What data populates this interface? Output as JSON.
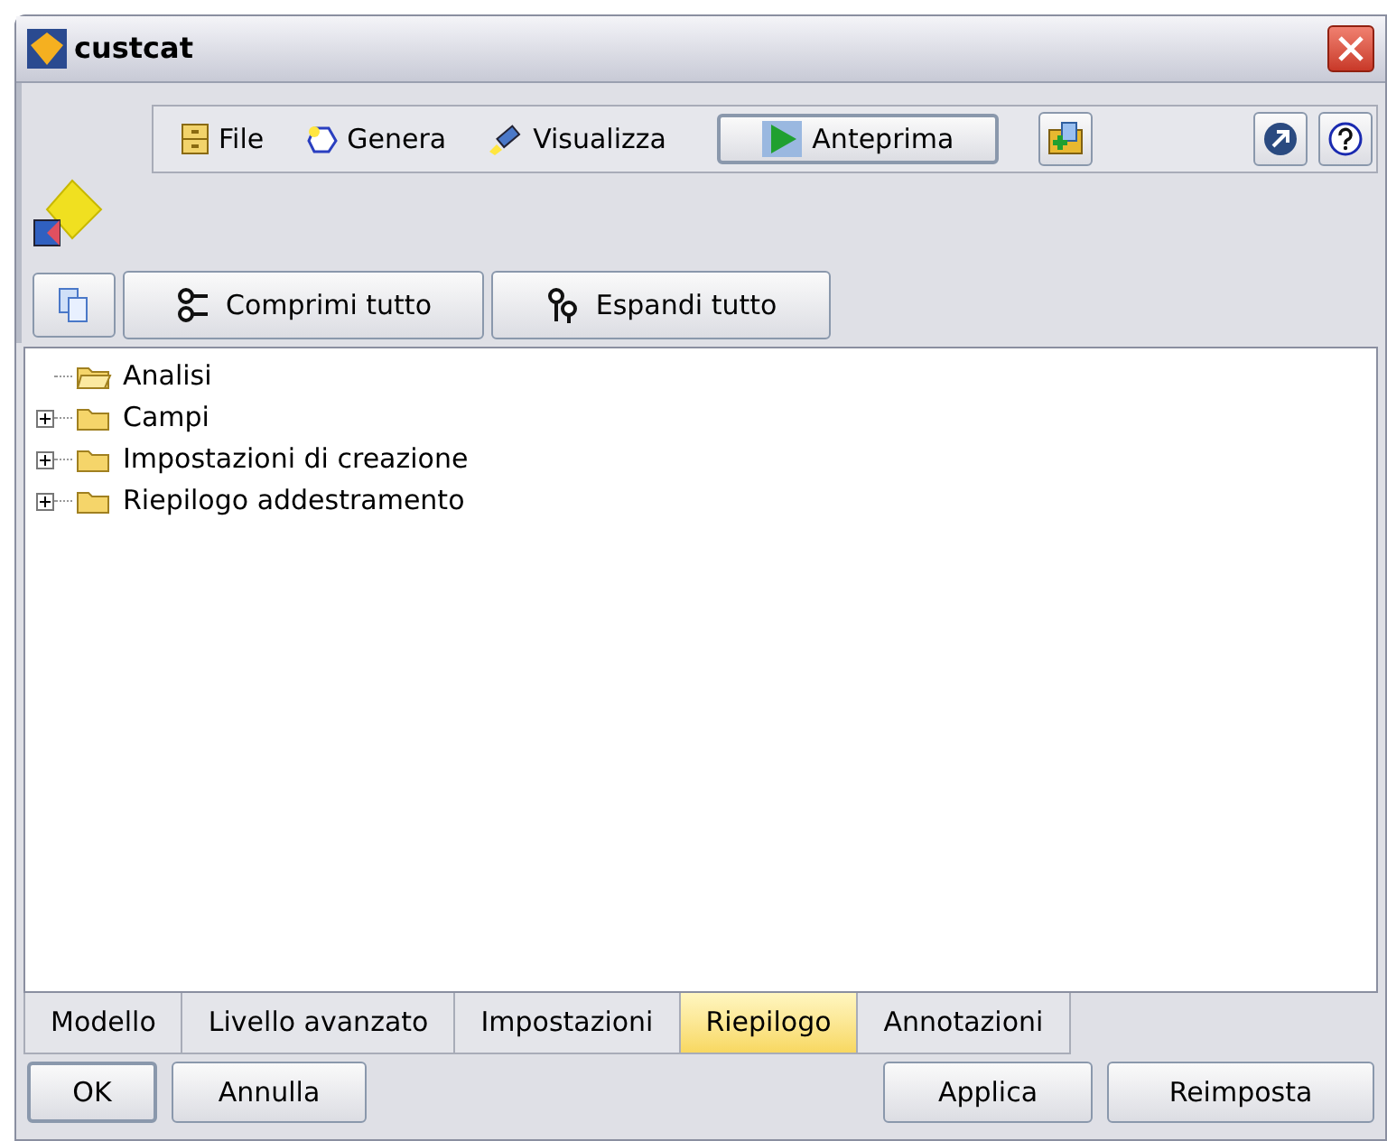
{
  "window": {
    "title": "custcat"
  },
  "toolbar": {
    "menus": [
      {
        "label": "File",
        "kind": "file"
      },
      {
        "label": "Genera",
        "kind": "generate"
      },
      {
        "label": "Visualizza",
        "kind": "view"
      }
    ],
    "preview_button": "Anteprima"
  },
  "tree_toolbar": {
    "buttons": [
      "Comprimi tutto",
      "Espandi tutto"
    ]
  },
  "tree": [
    {
      "label": "Analisi",
      "kind": "leaf"
    },
    {
      "label": "Campi",
      "kind": "branch",
      "expanded": false
    },
    {
      "label": "Impostazioni di creazione",
      "kind": "branch",
      "expanded": false
    },
    {
      "label": "Riepilogo addestramento",
      "kind": "branch",
      "expanded": false
    }
  ],
  "tabs": [
    {
      "label": "Modello",
      "selected": false
    },
    {
      "label": "Livello avanzato",
      "selected": false
    },
    {
      "label": "Impostazioni",
      "selected": false
    },
    {
      "label": "Riepilogo",
      "selected": true
    },
    {
      "label": "Annotazioni",
      "selected": false
    }
  ],
  "buttons_left": [
    "OK",
    "Annulla"
  ],
  "buttons_right": [
    "Applica",
    "Reimposta"
  ]
}
